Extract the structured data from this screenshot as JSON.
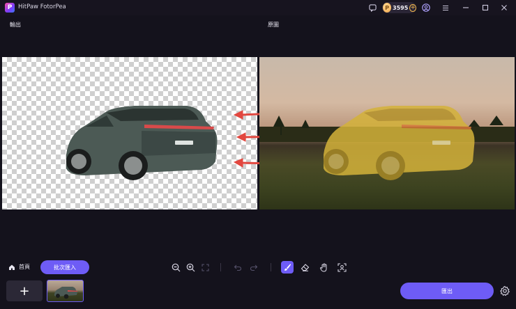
{
  "app": {
    "title": "HitPaw FotorPea",
    "logo_letter": "P"
  },
  "titlebar": {
    "credits": "3595",
    "icons": [
      "chat-icon",
      "coin-icon",
      "add-credits-icon",
      "account-icon",
      "menu-icon",
      "minimize-icon",
      "maximize-icon",
      "close-icon"
    ]
  },
  "panes": {
    "output_label": "輸出",
    "original_label": "原圖"
  },
  "toolbar": {
    "home_label": "首頁",
    "batch_import_label": "批次匯入",
    "tools": [
      "zoom-out-icon",
      "zoom-in-icon",
      "fit-screen-icon",
      "undo-icon",
      "redo-icon",
      "brush-icon",
      "eraser-icon",
      "hand-icon",
      "select-subject-icon"
    ],
    "active_tool": "brush-icon"
  },
  "bottom": {
    "add_symbol": "+",
    "export_label": "匯出"
  },
  "colors": {
    "accent": "#6e5cf6",
    "background": "#14121c",
    "credit_coin": "#f0a64a",
    "arrow": "#e2473f",
    "mask": "#d4b23a"
  }
}
